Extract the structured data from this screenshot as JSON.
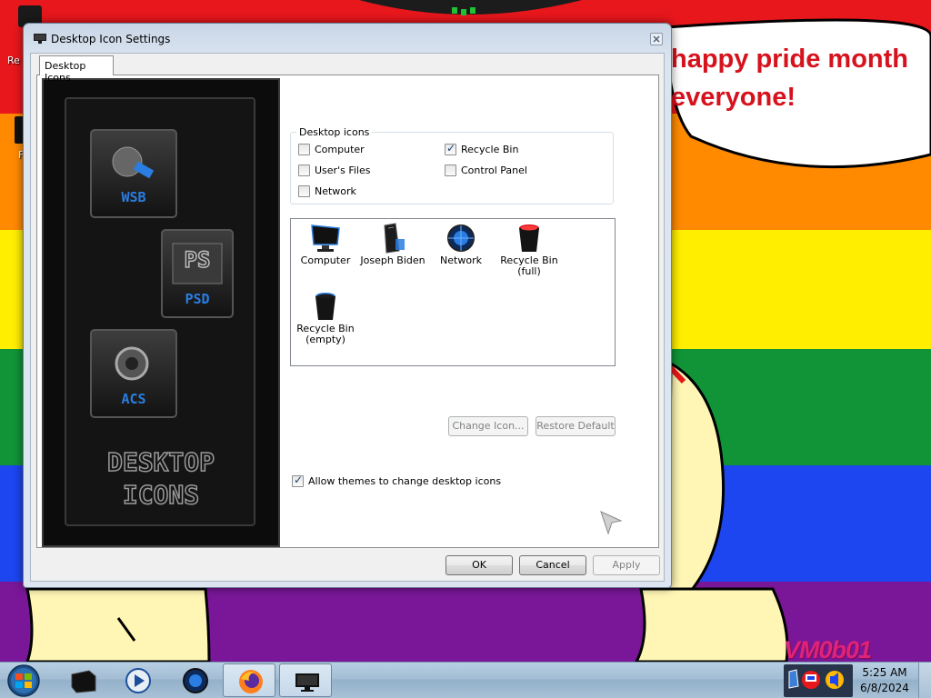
{
  "window": {
    "title": "Desktop Icon Settings",
    "tab_label": "Desktop Icons"
  },
  "preview": {
    "tiles": [
      "WSB",
      "PSD",
      "ACS"
    ],
    "ps_glyph": "PS",
    "caption_line1": "DESKTOP",
    "caption_line2": "ICONS"
  },
  "desktop_icons_group": {
    "label": "Desktop icons",
    "checkboxes": [
      {
        "label": "Computer",
        "checked": false
      },
      {
        "label": "User's Files",
        "checked": false
      },
      {
        "label": "Network",
        "checked": false
      },
      {
        "label": "Recycle Bin",
        "checked": true
      },
      {
        "label": "Control Panel",
        "checked": false
      }
    ]
  },
  "icon_list": [
    {
      "label": "Computer",
      "icon": "computer-icon"
    },
    {
      "label": "Joseph Biden",
      "icon": "user-files-icon"
    },
    {
      "label": "Network",
      "icon": "network-icon"
    },
    {
      "label": "Recycle Bin (full)",
      "line1": "Recycle Bin",
      "line2": "(full)",
      "icon": "recycle-bin-full-icon"
    },
    {
      "label": "Recycle Bin (empty)",
      "line1": "Recycle Bin",
      "line2": "(empty)",
      "icon": "recycle-bin-empty-icon"
    }
  ],
  "buttons": {
    "change_icon": "Change Icon...",
    "restore_default": "Restore Default",
    "ok": "OK",
    "cancel": "Cancel",
    "apply": "Apply"
  },
  "allow_themes": {
    "label": "Allow themes to change desktop icons",
    "checked": true
  },
  "wallpaper": {
    "speech_line1": "happy pride month",
    "speech_line2": "everyone!",
    "watermark": "VM0b01",
    "desk_icon_1_label": "Re",
    "desk_icon_2_label": "F"
  },
  "taskbar": {
    "time": "5:25 AM",
    "date": "6/8/2024",
    "buttons": [
      "start-button",
      "explorer-icon",
      "media-player-icon",
      "network-globe-icon",
      "firefox-icon",
      "display-settings-icon"
    ]
  },
  "colors": {
    "accent_blue": "#2a7de1",
    "pride_red": "#e8171c",
    "pride_orange": "#ff8a00",
    "pride_yellow": "#ffee00",
    "pride_green": "#119437",
    "pride_blue": "#1d45f0",
    "pride_purple": "#7a1798"
  }
}
